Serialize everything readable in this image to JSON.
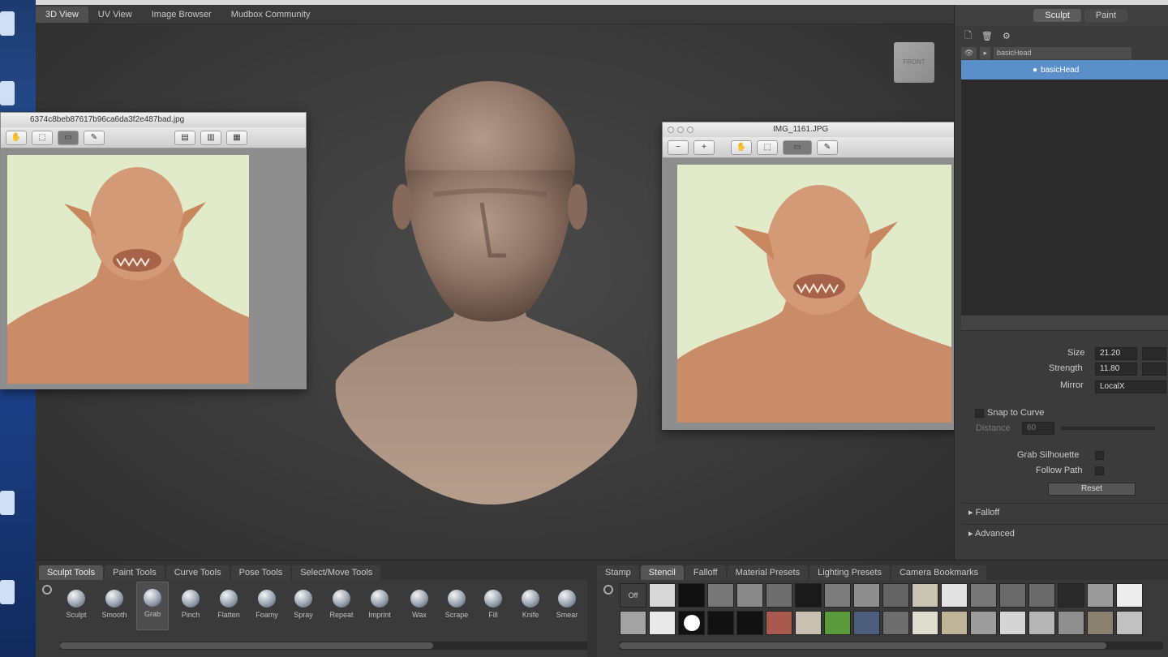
{
  "viewport_tabs": [
    "3D View",
    "UV View",
    "Image Browser",
    "Mudbox Community"
  ],
  "viewcube_label": "FRONT",
  "image_windows": [
    {
      "title": "6374c8beb87617b96ca6da3f2e487bad.jpg"
    },
    {
      "title": "IMG_1161.JPG"
    }
  ],
  "right_panel": {
    "tabs": [
      "Sculpt",
      "Paint"
    ],
    "layer_header_name": "basicHead",
    "layer_row_name": "basicHead",
    "properties": {
      "size_label": "Size",
      "size_value": "21.20",
      "strength_label": "Strength",
      "strength_value": "11.80",
      "mirror_label": "Mirror",
      "mirror_value": "LocalX",
      "snap_label": "Snap to Curve",
      "distance_label": "Distance",
      "distance_value": "60",
      "grab_silhouette_label": "Grab Silhouette",
      "follow_path_label": "Follow Path",
      "reset_label": "Reset"
    },
    "sections": [
      "Falloff",
      "Advanced"
    ]
  },
  "tool_tabs": [
    "Sculpt Tools",
    "Paint Tools",
    "Curve Tools",
    "Pose Tools",
    "Select/Move Tools"
  ],
  "tools": [
    "Sculpt",
    "Smooth",
    "Grab",
    "Pinch",
    "Flatten",
    "Foamy",
    "Spray",
    "Repeat",
    "Imprint",
    "Wax",
    "Scrape",
    "Fill",
    "Knife",
    "Smear"
  ],
  "tray_tabs": [
    "Stamp",
    "Stencil",
    "Falloff",
    "Material Presets",
    "Lighting Presets",
    "Camera Bookmarks"
  ],
  "stamp_off_label": "Off",
  "colors": {
    "selection_blue": "#5b8fc8",
    "panel": "#3b3b3b",
    "viewport": "#3d3d3d",
    "skin": "#9c8374"
  }
}
